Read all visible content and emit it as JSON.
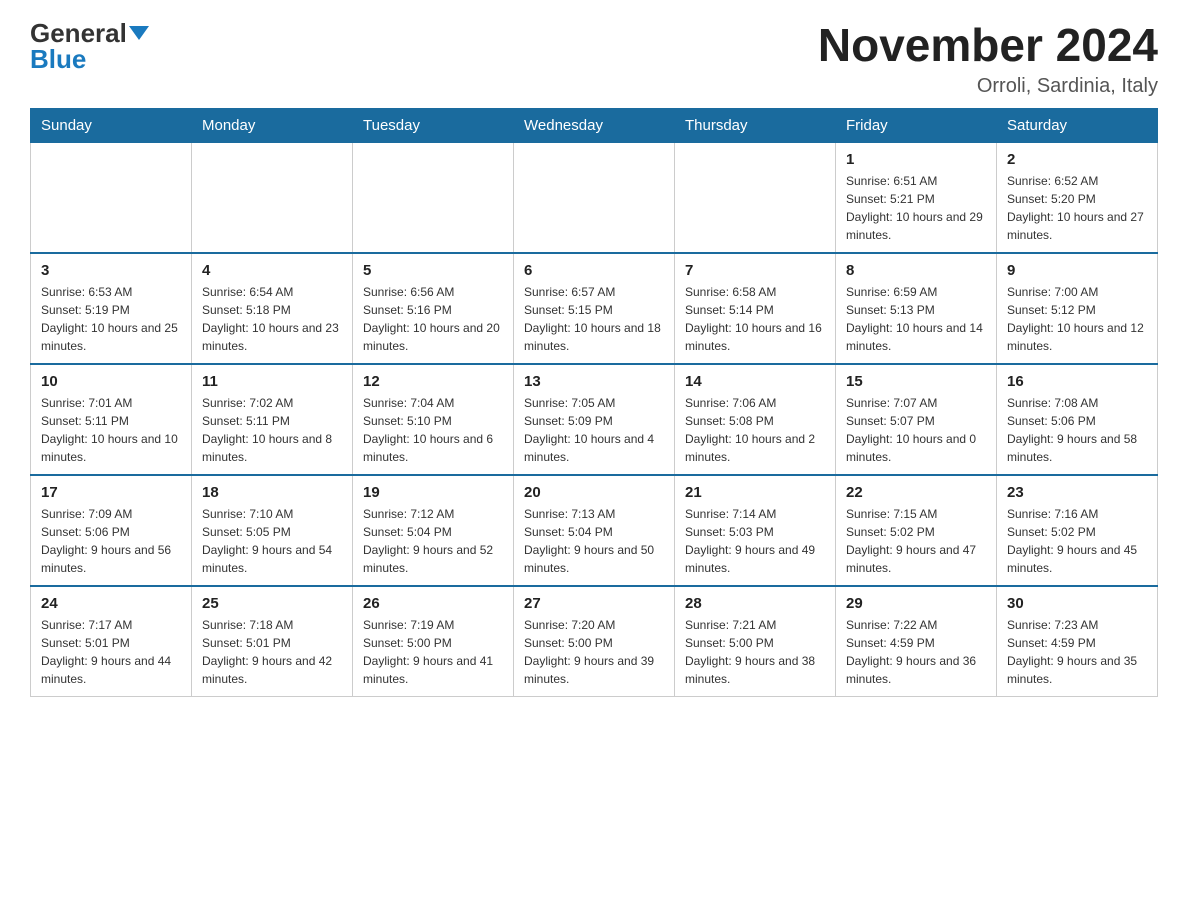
{
  "header": {
    "logo_general": "General",
    "logo_blue": "Blue",
    "month_title": "November 2024",
    "location": "Orroli, Sardinia, Italy"
  },
  "days_of_week": [
    "Sunday",
    "Monday",
    "Tuesday",
    "Wednesday",
    "Thursday",
    "Friday",
    "Saturday"
  ],
  "weeks": [
    [
      {
        "day": "",
        "info": ""
      },
      {
        "day": "",
        "info": ""
      },
      {
        "day": "",
        "info": ""
      },
      {
        "day": "",
        "info": ""
      },
      {
        "day": "",
        "info": ""
      },
      {
        "day": "1",
        "info": "Sunrise: 6:51 AM\nSunset: 5:21 PM\nDaylight: 10 hours and 29 minutes."
      },
      {
        "day": "2",
        "info": "Sunrise: 6:52 AM\nSunset: 5:20 PM\nDaylight: 10 hours and 27 minutes."
      }
    ],
    [
      {
        "day": "3",
        "info": "Sunrise: 6:53 AM\nSunset: 5:19 PM\nDaylight: 10 hours and 25 minutes."
      },
      {
        "day": "4",
        "info": "Sunrise: 6:54 AM\nSunset: 5:18 PM\nDaylight: 10 hours and 23 minutes."
      },
      {
        "day": "5",
        "info": "Sunrise: 6:56 AM\nSunset: 5:16 PM\nDaylight: 10 hours and 20 minutes."
      },
      {
        "day": "6",
        "info": "Sunrise: 6:57 AM\nSunset: 5:15 PM\nDaylight: 10 hours and 18 minutes."
      },
      {
        "day": "7",
        "info": "Sunrise: 6:58 AM\nSunset: 5:14 PM\nDaylight: 10 hours and 16 minutes."
      },
      {
        "day": "8",
        "info": "Sunrise: 6:59 AM\nSunset: 5:13 PM\nDaylight: 10 hours and 14 minutes."
      },
      {
        "day": "9",
        "info": "Sunrise: 7:00 AM\nSunset: 5:12 PM\nDaylight: 10 hours and 12 minutes."
      }
    ],
    [
      {
        "day": "10",
        "info": "Sunrise: 7:01 AM\nSunset: 5:11 PM\nDaylight: 10 hours and 10 minutes."
      },
      {
        "day": "11",
        "info": "Sunrise: 7:02 AM\nSunset: 5:11 PM\nDaylight: 10 hours and 8 minutes."
      },
      {
        "day": "12",
        "info": "Sunrise: 7:04 AM\nSunset: 5:10 PM\nDaylight: 10 hours and 6 minutes."
      },
      {
        "day": "13",
        "info": "Sunrise: 7:05 AM\nSunset: 5:09 PM\nDaylight: 10 hours and 4 minutes."
      },
      {
        "day": "14",
        "info": "Sunrise: 7:06 AM\nSunset: 5:08 PM\nDaylight: 10 hours and 2 minutes."
      },
      {
        "day": "15",
        "info": "Sunrise: 7:07 AM\nSunset: 5:07 PM\nDaylight: 10 hours and 0 minutes."
      },
      {
        "day": "16",
        "info": "Sunrise: 7:08 AM\nSunset: 5:06 PM\nDaylight: 9 hours and 58 minutes."
      }
    ],
    [
      {
        "day": "17",
        "info": "Sunrise: 7:09 AM\nSunset: 5:06 PM\nDaylight: 9 hours and 56 minutes."
      },
      {
        "day": "18",
        "info": "Sunrise: 7:10 AM\nSunset: 5:05 PM\nDaylight: 9 hours and 54 minutes."
      },
      {
        "day": "19",
        "info": "Sunrise: 7:12 AM\nSunset: 5:04 PM\nDaylight: 9 hours and 52 minutes."
      },
      {
        "day": "20",
        "info": "Sunrise: 7:13 AM\nSunset: 5:04 PM\nDaylight: 9 hours and 50 minutes."
      },
      {
        "day": "21",
        "info": "Sunrise: 7:14 AM\nSunset: 5:03 PM\nDaylight: 9 hours and 49 minutes."
      },
      {
        "day": "22",
        "info": "Sunrise: 7:15 AM\nSunset: 5:02 PM\nDaylight: 9 hours and 47 minutes."
      },
      {
        "day": "23",
        "info": "Sunrise: 7:16 AM\nSunset: 5:02 PM\nDaylight: 9 hours and 45 minutes."
      }
    ],
    [
      {
        "day": "24",
        "info": "Sunrise: 7:17 AM\nSunset: 5:01 PM\nDaylight: 9 hours and 44 minutes."
      },
      {
        "day": "25",
        "info": "Sunrise: 7:18 AM\nSunset: 5:01 PM\nDaylight: 9 hours and 42 minutes."
      },
      {
        "day": "26",
        "info": "Sunrise: 7:19 AM\nSunset: 5:00 PM\nDaylight: 9 hours and 41 minutes."
      },
      {
        "day": "27",
        "info": "Sunrise: 7:20 AM\nSunset: 5:00 PM\nDaylight: 9 hours and 39 minutes."
      },
      {
        "day": "28",
        "info": "Sunrise: 7:21 AM\nSunset: 5:00 PM\nDaylight: 9 hours and 38 minutes."
      },
      {
        "day": "29",
        "info": "Sunrise: 7:22 AM\nSunset: 4:59 PM\nDaylight: 9 hours and 36 minutes."
      },
      {
        "day": "30",
        "info": "Sunrise: 7:23 AM\nSunset: 4:59 PM\nDaylight: 9 hours and 35 minutes."
      }
    ]
  ]
}
